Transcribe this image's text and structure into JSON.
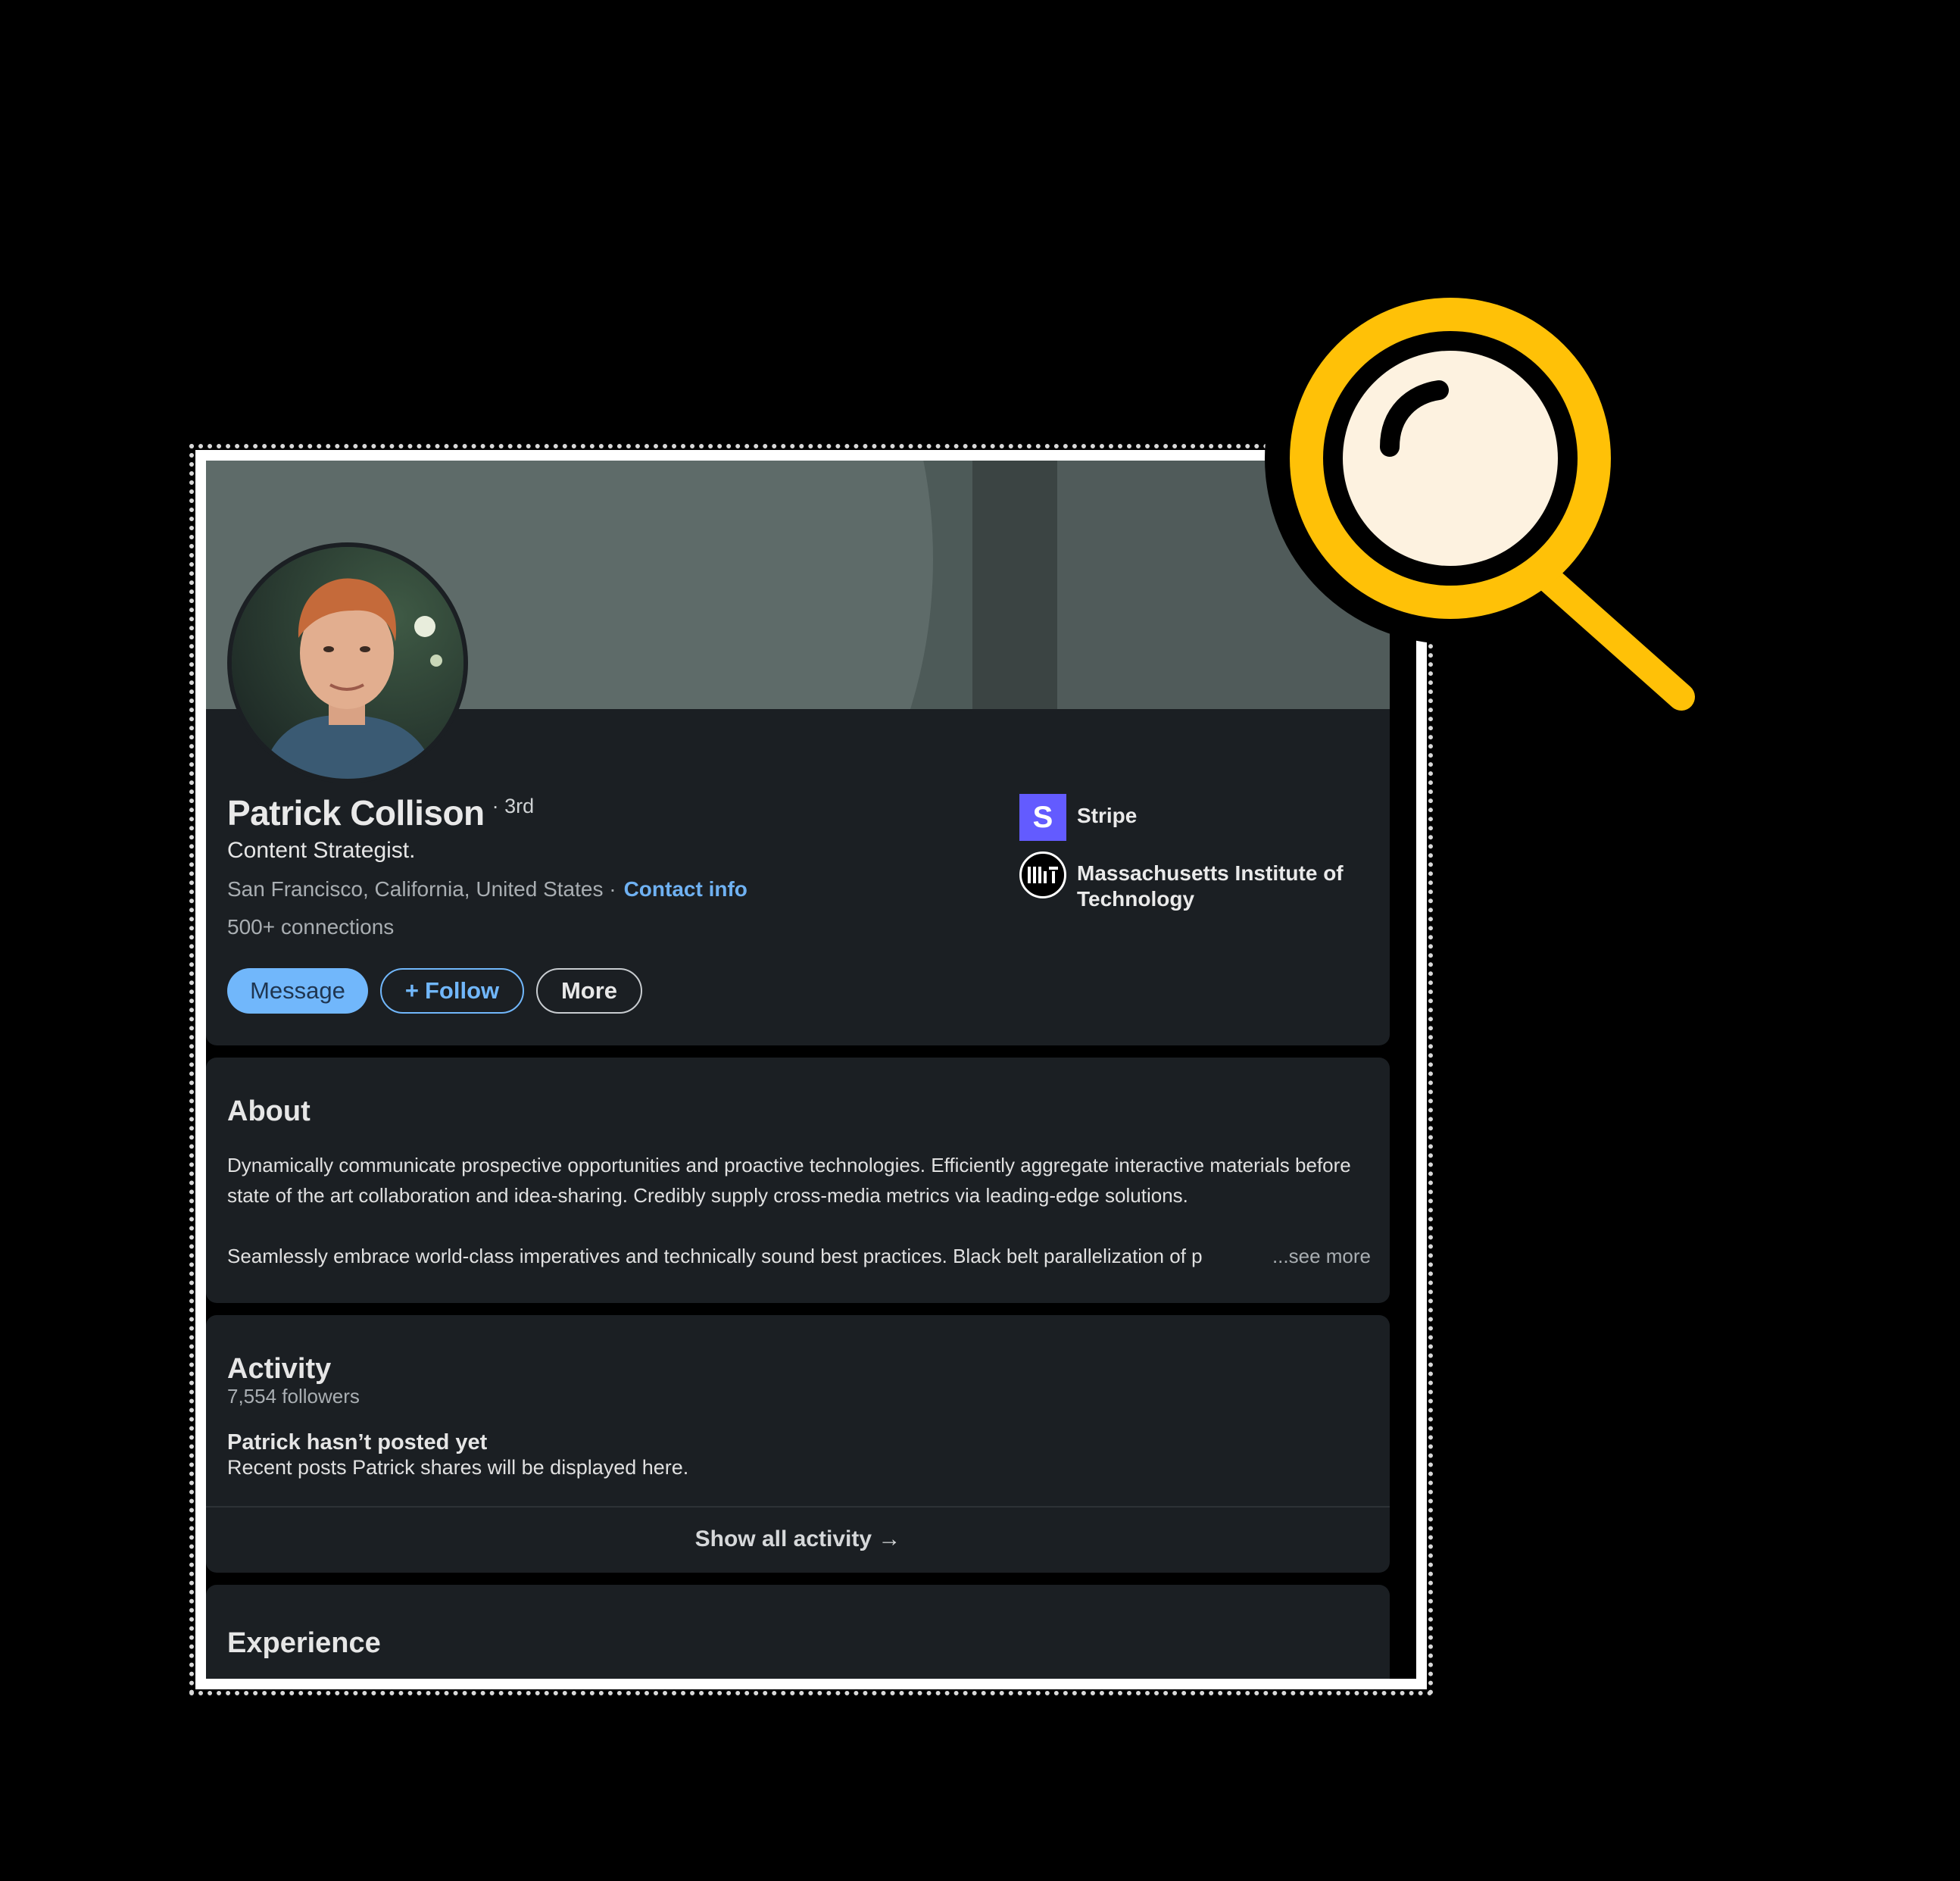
{
  "profile": {
    "name": "Patrick Collison",
    "degree": "· 3rd",
    "headline": "Content Strategist.",
    "location": "San Francisco, California, United States ·",
    "contact_info": "Contact info",
    "connections": "500+ connections"
  },
  "actions": {
    "message": "Message",
    "follow": "Follow",
    "follow_prefix": "+",
    "more": "More"
  },
  "affiliations": [
    {
      "name": "Stripe",
      "logo_letter": "S"
    },
    {
      "name": "Massachusetts Institute of Technology",
      "logo_text": "MIT"
    }
  ],
  "about": {
    "title": "About",
    "paragraph1": "Dynamically communicate prospective opportunities and proactive technologies. Efficiently aggregate interactive materials before state of the art collaboration and idea-sharing. Credibly supply cross-media metrics via leading-edge solutions.",
    "paragraph2": "Seamlessly embrace world-class imperatives and technically sound best practices. Black belt parallelization of p",
    "see_more": "...see more"
  },
  "activity": {
    "title": "Activity",
    "followers": "7,554 followers",
    "empty_title": "Patrick hasn’t posted yet",
    "empty_subtitle": "Recent posts Patrick shares will be displayed here.",
    "show_all": "Show all activity →"
  },
  "experience": {
    "title": "Experience"
  },
  "colors": {
    "accent": "#71b7fb",
    "card_bg": "#1b1f23",
    "stripe_brand": "#635bff",
    "magnifier_yellow": "#ffc107"
  },
  "icons": {
    "magnifier": "magnifying-glass-icon",
    "arrow": "arrow-right-icon",
    "plus": "plus-icon"
  }
}
